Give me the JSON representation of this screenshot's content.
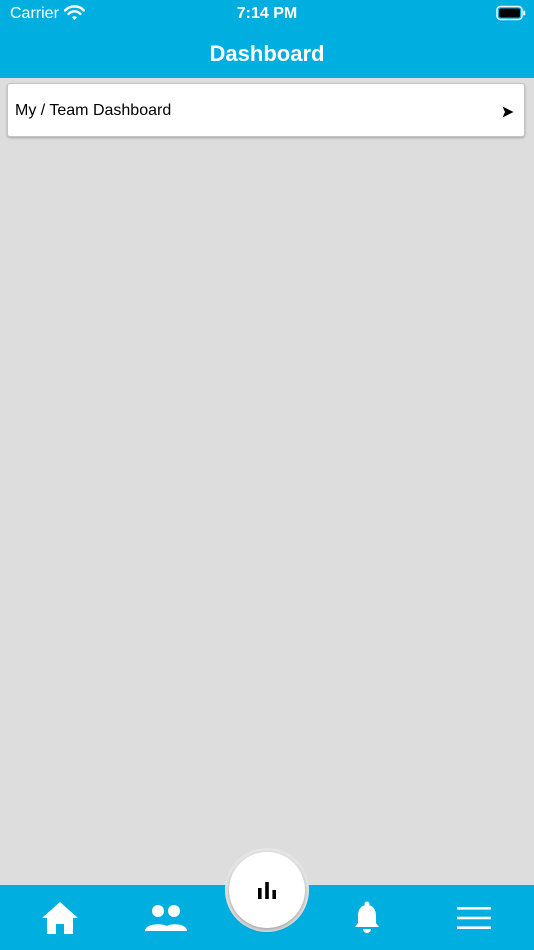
{
  "status_bar": {
    "carrier": "Carrier",
    "time": "7:14 PM"
  },
  "header": {
    "title": "Dashboard"
  },
  "dashboard_list": {
    "items": [
      {
        "label": "My / Team Dashboard",
        "icon": "arrow-right-icon"
      }
    ]
  },
  "bottom_nav": {
    "items": [
      {
        "icon": "home-icon"
      },
      {
        "icon": "people-icon"
      },
      {
        "icon": "bar-chart-icon"
      },
      {
        "icon": "bell-icon"
      },
      {
        "icon": "menu-icon"
      }
    ]
  },
  "colors": {
    "primary": "#00aee0",
    "background": "#dddddd",
    "card": "#ffffff"
  }
}
